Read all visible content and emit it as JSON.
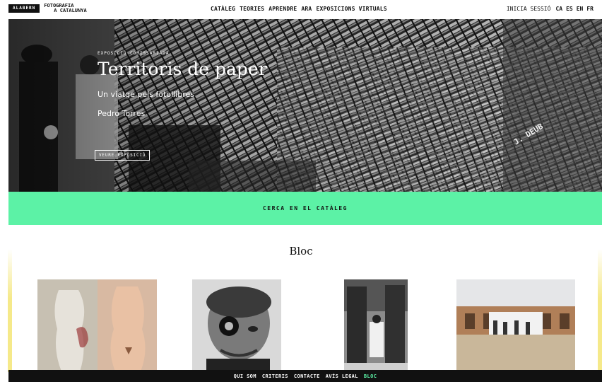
{
  "header": {
    "logo_box": "ALABERN",
    "logo_line1": "FOTOGRAFIA",
    "logo_line2": "A CATALUNYA",
    "nav": [
      "CATÀLEG",
      "TEORIES",
      "APRENDRE",
      "ARA",
      "EXPOSICIONS VIRTUALS"
    ],
    "login": "INICIA SESSIÓ",
    "languages": [
      "CA",
      "ES",
      "EN",
      "FR"
    ]
  },
  "hero": {
    "kicker": "EXPOSICIÓ COMISSARIADA",
    "title": "Territoris de paper",
    "subtitle": "Un viatge pels fotollibres",
    "author": "Pedro Torres",
    "button": "VEURE EXPOSICIÓ",
    "crate_label": "J. DEUB"
  },
  "search_band": {
    "label": "CERCA EN EL CATÀLEG"
  },
  "blog": {
    "title": "Bloc"
  },
  "footer": {
    "links": [
      "QUI SOM",
      "CRITERIS",
      "CONTACTE",
      "AVÍS LEGAL",
      "BLOC"
    ]
  },
  "colors": {
    "accent": "#5cf2a6",
    "dark": "#111111"
  }
}
